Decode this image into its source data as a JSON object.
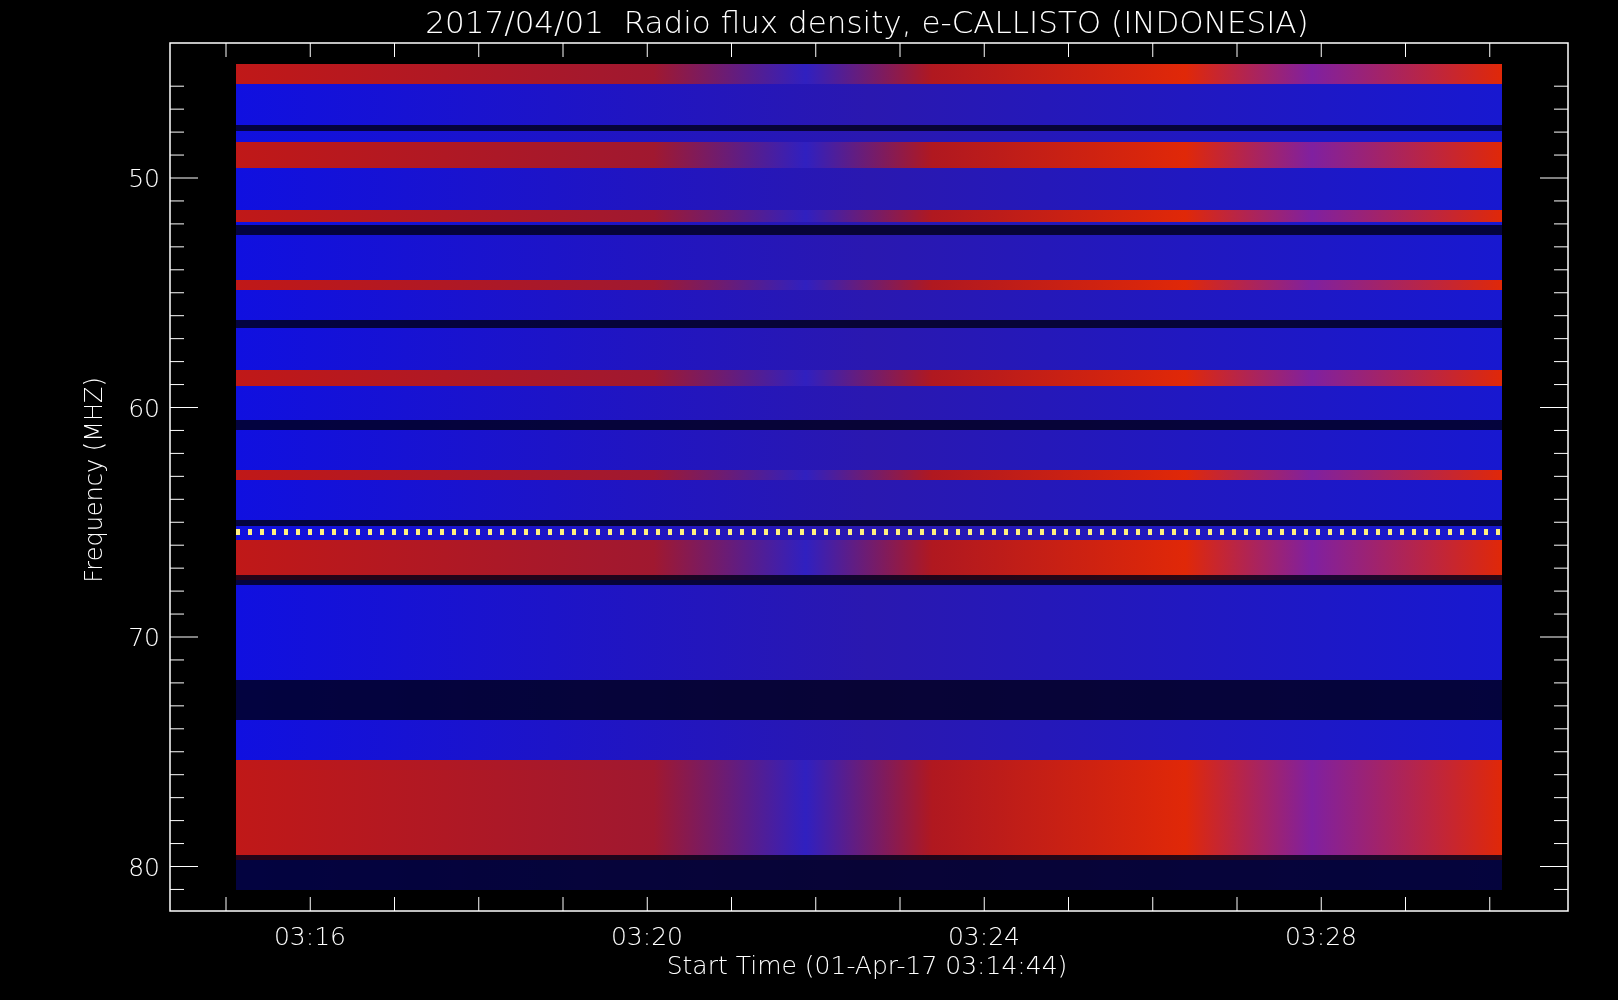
{
  "title": "2017/04/01  Radio flux density, e-CALLISTO (INDONESIA)",
  "y_axis": {
    "label": "Frequency (MHZ)",
    "ticks": [
      "50",
      "60",
      "70",
      "80"
    ]
  },
  "x_axis": {
    "label": "Start Time (01-Apr-17 03:14:44)",
    "ticks": [
      "03:16",
      "03:20",
      "03:24",
      "03:28"
    ]
  }
}
